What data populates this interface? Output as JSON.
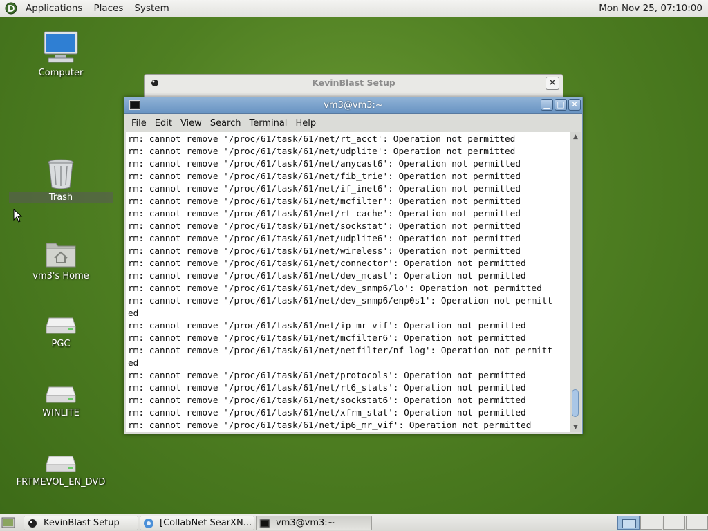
{
  "top_panel": {
    "menus": [
      "Applications",
      "Places",
      "System"
    ],
    "clock": "Mon Nov 25, 07:10:00"
  },
  "desktop_icons": [
    {
      "label": "Computer",
      "icon": "computer-icon"
    },
    {
      "label": "Trash",
      "icon": "trash-icon"
    },
    {
      "label": "vm3's Home",
      "icon": "home-folder-icon"
    },
    {
      "label": "PGC",
      "icon": "drive-icon"
    },
    {
      "label": "WINLITE",
      "icon": "drive-icon"
    },
    {
      "label": "FRTMEVOL_EN_DVD",
      "icon": "drive-icon"
    }
  ],
  "background_dialog": {
    "title": "KevinBlast Setup"
  },
  "terminal": {
    "title": "vm3@vm3:~",
    "menu": [
      "File",
      "Edit",
      "View",
      "Search",
      "Terminal",
      "Help"
    ],
    "lines": [
      "rm: cannot remove '/proc/61/task/61/net/rt_acct': Operation not permitted",
      "rm: cannot remove '/proc/61/task/61/net/udplite': Operation not permitted",
      "rm: cannot remove '/proc/61/task/61/net/anycast6': Operation not permitted",
      "rm: cannot remove '/proc/61/task/61/net/fib_trie': Operation not permitted",
      "rm: cannot remove '/proc/61/task/61/net/if_inet6': Operation not permitted",
      "rm: cannot remove '/proc/61/task/61/net/mcfilter': Operation not permitted",
      "rm: cannot remove '/proc/61/task/61/net/rt_cache': Operation not permitted",
      "rm: cannot remove '/proc/61/task/61/net/sockstat': Operation not permitted",
      "rm: cannot remove '/proc/61/task/61/net/udplite6': Operation not permitted",
      "rm: cannot remove '/proc/61/task/61/net/wireless': Operation not permitted",
      "rm: cannot remove '/proc/61/task/61/net/connector': Operation not permitted",
      "rm: cannot remove '/proc/61/task/61/net/dev_mcast': Operation not permitted",
      "rm: cannot remove '/proc/61/task/61/net/dev_snmp6/lo': Operation not permitted",
      "rm: cannot remove '/proc/61/task/61/net/dev_snmp6/enp0s1': Operation not permitt",
      "ed",
      "rm: cannot remove '/proc/61/task/61/net/ip_mr_vif': Operation not permitted",
      "rm: cannot remove '/proc/61/task/61/net/mcfilter6': Operation not permitted",
      "rm: cannot remove '/proc/61/task/61/net/netfilter/nf_log': Operation not permitt",
      "ed",
      "rm: cannot remove '/proc/61/task/61/net/protocols': Operation not permitted",
      "rm: cannot remove '/proc/61/task/61/net/rt6_stats': Operation not permitted",
      "rm: cannot remove '/proc/61/task/61/net/sockstat6': Operation not permitted",
      "rm: cannot remove '/proc/61/task/61/net/xfrm_stat': Operation not permitted",
      "rm: cannot remove '/proc/61/task/61/net/ip6_mr_vif': Operation not permitted"
    ]
  },
  "taskbar": {
    "tasks": [
      {
        "label": "KevinBlast Setup",
        "icon": "setup-icon"
      },
      {
        "label": "[CollabNet SearXN...",
        "icon": "browser-icon"
      },
      {
        "label": "vm3@vm3:~",
        "icon": "terminal-icon"
      }
    ]
  }
}
